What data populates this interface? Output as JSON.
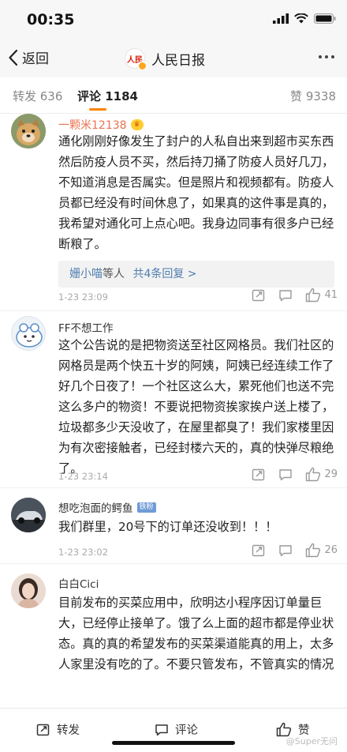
{
  "status_bar": {
    "time": "00:35"
  },
  "nav": {
    "back_label": "返回",
    "title": "人民日报",
    "logo_text": "人民日报"
  },
  "tabs": {
    "repost": "转发 636",
    "comments": "评论 1184",
    "likes": "赞 9338"
  },
  "comments": [
    {
      "name": "一颗米12138",
      "text": "通化刚刚好像发生了封户的人私自出来到超市买东西然后防疫人员不买，然后持刀捅了防疫人员好几刀，不知道消息是否属实。但是照片和视频都有。防疫人员都已经没有时间休息了，如果真的这件事是真的，我希望对通化可上点心吧。我身边同事有很多户已经断粮了。",
      "reply_user": "姗小喵",
      "reply_mid": "等人",
      "reply_count": "共4条回复 >",
      "time": "1-23 23:09",
      "likes": "41"
    },
    {
      "name": "FF不想工作",
      "text": "这个公告说的是把物资送至社区网格员。我们社区的网格员是两个快五十岁的阿姨，阿姨已经连续工作了好几个日夜了！一个社区这么大，累死他们也送不完这么多户的物资！不要说把物资挨家挨户送上楼了，垃圾都多少天没收了，在屋里都臭了！我们家楼里因为有次密接触者，已经封楼六天的，真的快弹尽粮绝了。",
      "time": "1-23 23:14",
      "likes": "29"
    },
    {
      "name": "想吃泡面的鳄鱼",
      "badge": "铁粉",
      "text": "我们群里，20号下的订单还没收到！！！",
      "time": "1-23 23:02",
      "likes": "26"
    },
    {
      "name": "白白Cici",
      "text": "目前发布的买菜应用中，欣明达小程序因订单量巨大，已经停止接单了。饿了么上面的超市都是停业状态。真的真的希望发布的买菜渠道能真的用上，太多人家里没有吃的了。不要只管发布，不管真实的情况"
    }
  ],
  "bottom_bar": {
    "repost": "转发",
    "comment": "评论",
    "like": "赞"
  },
  "watermark": "@Super无问",
  "colors": {
    "accent": "#ff8200",
    "link": "#507daf",
    "name_orange": "#eb7350"
  }
}
